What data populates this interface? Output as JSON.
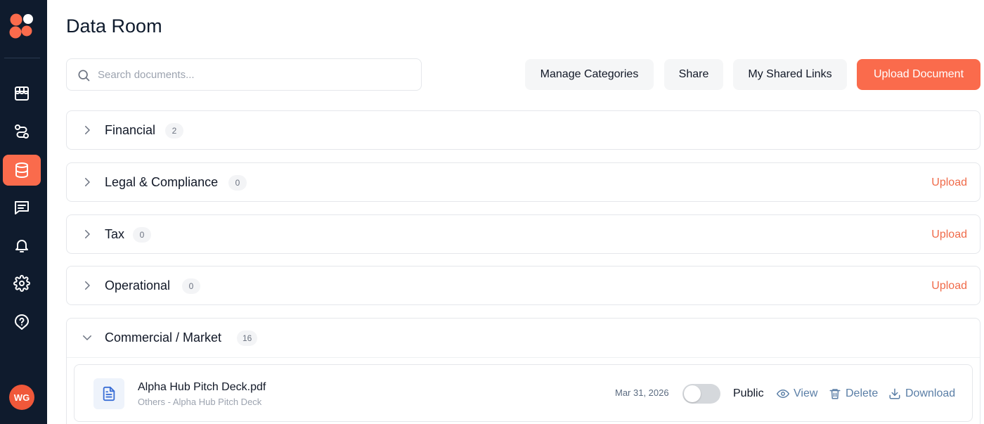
{
  "page": {
    "title": "Data Room"
  },
  "sidebar": {
    "items": [
      {
        "icon": "store-icon"
      },
      {
        "icon": "route-icon"
      },
      {
        "icon": "database-icon",
        "active": true
      },
      {
        "icon": "message-icon"
      },
      {
        "icon": "bell-icon"
      },
      {
        "icon": "gear-icon"
      },
      {
        "icon": "help-icon"
      }
    ],
    "avatar_initials": "WG"
  },
  "search": {
    "placeholder": "Search documents..."
  },
  "toolbar": {
    "manage_categories": "Manage Categories",
    "share": "Share",
    "my_shared_links": "My Shared Links",
    "upload_document": "Upload Document"
  },
  "categories": [
    {
      "name": "Financial",
      "count": "2",
      "upload": ""
    },
    {
      "name": "Legal & Compliance",
      "count": "0",
      "upload": "Upload"
    },
    {
      "name": "Tax",
      "count": "0",
      "upload": "Upload"
    },
    {
      "name": "Operational",
      "count": "0",
      "upload": "Upload"
    },
    {
      "name": "Commercial / Market",
      "count": "16",
      "upload": ""
    }
  ],
  "file": {
    "name": "Alpha Hub Pitch Deck.pdf",
    "subtitle": "Others - Alpha Hub Pitch Deck",
    "date": "Mar 31, 2026",
    "public_label": "Public",
    "public_on": false,
    "view": "View",
    "delete": "Delete",
    "download": "Download"
  },
  "colors": {
    "accent": "#fa6b4c",
    "sidebar": "#0f1b2d",
    "link": "#5a7ea6"
  }
}
